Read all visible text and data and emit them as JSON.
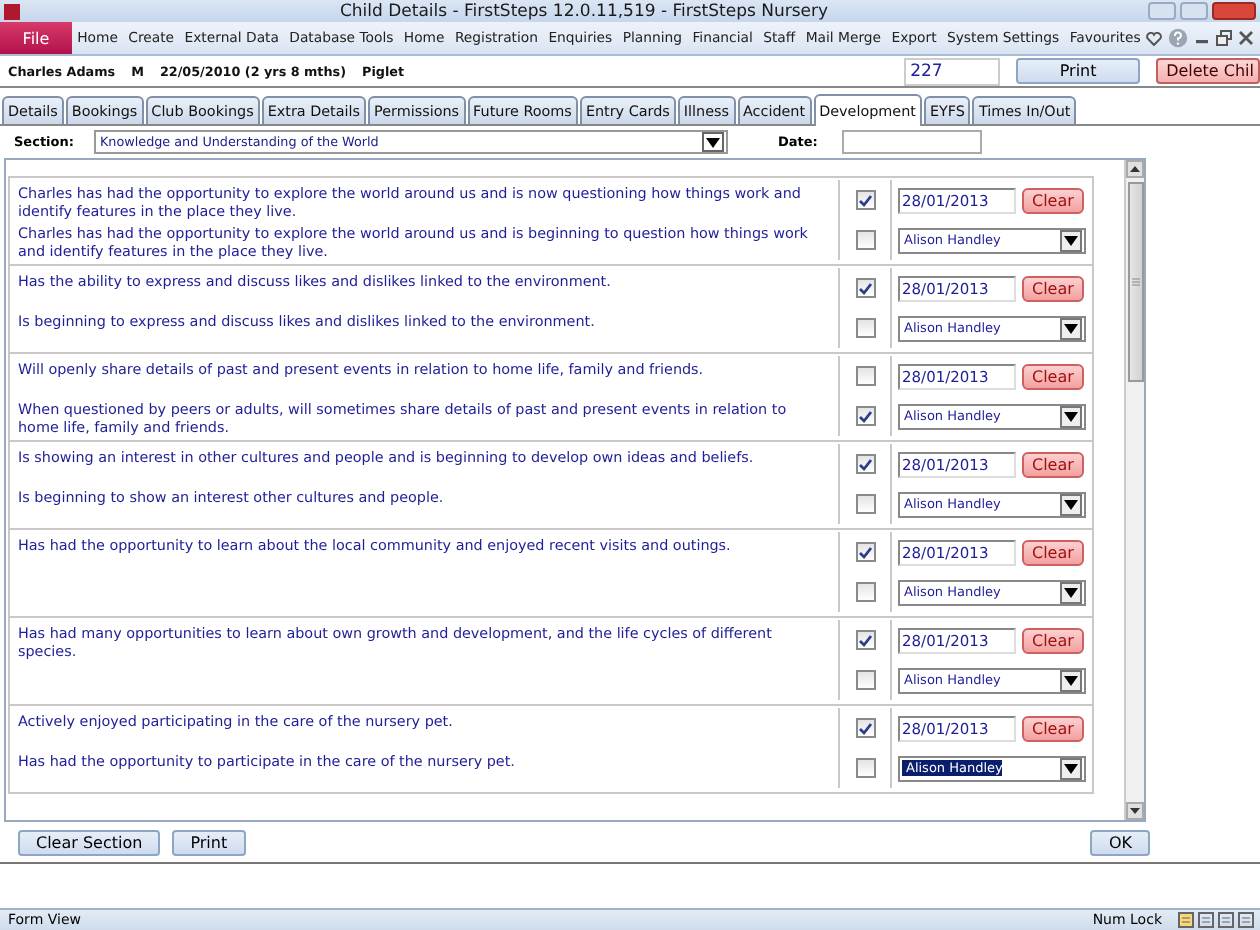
{
  "window": {
    "title": "Child Details  -  FirstSteps 12.0.11,519 - FirstSteps Nursery"
  },
  "ribbon": {
    "file": "File",
    "items": [
      "Home",
      "Create",
      "External Data",
      "Database Tools",
      "Home",
      "Registration",
      "Enquiries",
      "Planning",
      "Financial",
      "Staff",
      "Mail Merge",
      "Export",
      "System Settings",
      "Favourites"
    ]
  },
  "child": {
    "name": "Charles Adams",
    "gender": "M",
    "dob": "22/05/2010 (2 yrs 8 mths)",
    "room": "Piglet",
    "number": "227",
    "print": "Print",
    "delete": "Delete Chil"
  },
  "tabs": [
    {
      "label": "Details",
      "selected": false
    },
    {
      "label": "Bookings",
      "selected": false
    },
    {
      "label": "Club Bookings",
      "selected": false
    },
    {
      "label": "Extra Details",
      "selected": false
    },
    {
      "label": "Permissions",
      "selected": false
    },
    {
      "label": "Future Rooms",
      "selected": false
    },
    {
      "label": "Entry Cards",
      "selected": false
    },
    {
      "label": "Illness",
      "selected": false
    },
    {
      "label": "Accident",
      "selected": false
    },
    {
      "label": "Development",
      "selected": true
    },
    {
      "label": "EYFS",
      "selected": false
    },
    {
      "label": "Times In/Out",
      "selected": false
    }
  ],
  "section": {
    "label": "Section:",
    "value": "Knowledge and Understanding of the World",
    "date_label": "Date:"
  },
  "groups": [
    {
      "statements": [
        {
          "text": "Charles has had the opportunity to explore the world around us and is now questioning how things work and identify features in the place they live.",
          "checked": true
        },
        {
          "text": "Charles has had the opportunity to explore the world around us and is beginning to question how things work and identify features in the place they live.",
          "checked": false
        }
      ],
      "date": "28/01/2013",
      "clear": "Clear",
      "staff": "Alison Handley",
      "highlighted": false
    },
    {
      "statements": [
        {
          "text": "Has the ability to express and discuss likes and dislikes linked to the  environment.",
          "checked": true
        },
        {
          "text": "Is beginning to express and discuss likes and dislikes linked to the environment.",
          "checked": false
        }
      ],
      "date": "28/01/2013",
      "clear": "Clear",
      "staff": "Alison Handley",
      "highlighted": false
    },
    {
      "statements": [
        {
          "text": "Will openly share details of past and present events in relation to home life, family and friends.",
          "checked": false
        },
        {
          "text": "When questioned by peers or adults, will sometimes share details of past and present events in relation to home life, family and friends.",
          "checked": true
        }
      ],
      "date": "28/01/2013",
      "clear": "Clear",
      "staff": "Alison Handley",
      "highlighted": false
    },
    {
      "statements": [
        {
          "text": "Is showing an interest in other cultures and people and is beginning to develop own ideas and beliefs.",
          "checked": true
        },
        {
          "text": "Is beginning to show an interest other cultures and people.",
          "checked": false
        }
      ],
      "date": "28/01/2013",
      "clear": "Clear",
      "staff": "Alison Handley",
      "highlighted": false
    },
    {
      "statements": [
        {
          "text": "Has had the opportunity to learn about the local community and enjoyed recent visits and outings.",
          "checked": true
        },
        {
          "checked": false
        }
      ],
      "date": "28/01/2013",
      "clear": "Clear",
      "staff": "Alison Handley",
      "highlighted": false
    },
    {
      "statements": [
        {
          "text": "Has had many opportunities to learn about own growth and development, and the life cycles of different species.",
          "checked": true
        },
        {
          "checked": false
        }
      ],
      "date": "28/01/2013",
      "clear": "Clear",
      "staff": "Alison Handley",
      "highlighted": false
    },
    {
      "statements": [
        {
          "text": "Actively enjoyed participating in the care of the nursery pet.",
          "checked": true
        },
        {
          "text": "Has had the opportunity to participate in the care of the nursery pet.",
          "checked": false
        }
      ],
      "date": "28/01/2013",
      "clear": "Clear",
      "staff": "Alison Handley",
      "highlighted": true
    }
  ],
  "footer": {
    "clear_section": "Clear Section",
    "print": "Print",
    "ok": "OK"
  },
  "status_bar": {
    "left": "Form View",
    "num_lock": "Num Lock"
  }
}
